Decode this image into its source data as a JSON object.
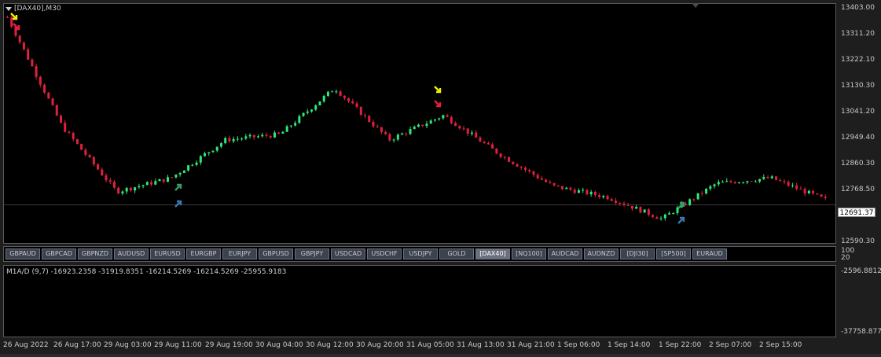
{
  "chart": {
    "title": "[DAX40],M30",
    "symbol": "DAX40",
    "timeframe": "M30",
    "current_price": "12691.37",
    "colors": {
      "bull": "#2ee878",
      "bear": "#e0203c",
      "up_arrow_green": "#3a9a64",
      "up_arrow_blue": "#3a78b0",
      "signal_yellow": "#f0f000",
      "background": "#000000"
    }
  },
  "price_axis": [
    "13403.00",
    "13311.20",
    "13222.10",
    "13130.30",
    "13041.20",
    "12949.40",
    "12860.30",
    "12768.50",
    "12590.30"
  ],
  "indicator": {
    "title": "M1A/D (9,7) -16923.2358 -31919.8351 -16214.5269 -16214.5269 -25955.9183",
    "axis_top": "-2596.8812",
    "axis_bottom": "-37758.877",
    "sym_axis": [
      "100",
      "20"
    ]
  },
  "symbols": [
    "GBPAUD",
    "GBPCAD",
    "GBPNZD",
    "AUDUSD",
    "EURUSD",
    "EURGBP",
    "EURJPY",
    "GBPUSD",
    "GBPJPY",
    "USDCAD",
    "USDCHF",
    "USDJPY",
    "GOLD",
    "[DAX40]",
    "[NQ100]",
    "AUDCAD",
    "AUDNZD",
    "[DJI30]",
    "[SP500]",
    "EURAUD"
  ],
  "active_symbol": "[DAX40]",
  "time_axis": [
    "26 Aug 2022",
    "26 Aug 17:00",
    "29 Aug 03:00",
    "29 Aug 11:00",
    "29 Aug 19:00",
    "30 Aug 04:00",
    "30 Aug 12:00",
    "30 Aug 20:00",
    "31 Aug 05:00",
    "31 Aug 13:00",
    "31 Aug 21:00",
    "1 Sep 06:00",
    "1 Sep 14:00",
    "1 Sep 22:00",
    "2 Sep 07:00",
    "2 Sep 15:00"
  ],
  "chart_data": {
    "type": "line",
    "ylim": [
      12560,
      13420
    ],
    "x": [
      "26 Aug 2022",
      "26 Aug 17:00",
      "29 Aug 03:00",
      "29 Aug 11:00",
      "29 Aug 19:00",
      "30 Aug 04:00",
      "30 Aug 12:00",
      "30 Aug 20:00",
      "31 Aug 05:00",
      "31 Aug 13:00",
      "31 Aug 21:00",
      "1 Sep 06:00",
      "1 Sep 14:00",
      "1 Sep 22:00",
      "2 Sep 07:00",
      "2 Sep 15:00"
    ],
    "series": [
      {
        "values": [
          13380,
          12980,
          12740,
          12790,
          12930,
          12950,
          13120,
          12930,
          13020,
          12880,
          12760,
          12720,
          12640,
          12770,
          12790,
          12710
        ]
      }
    ]
  }
}
